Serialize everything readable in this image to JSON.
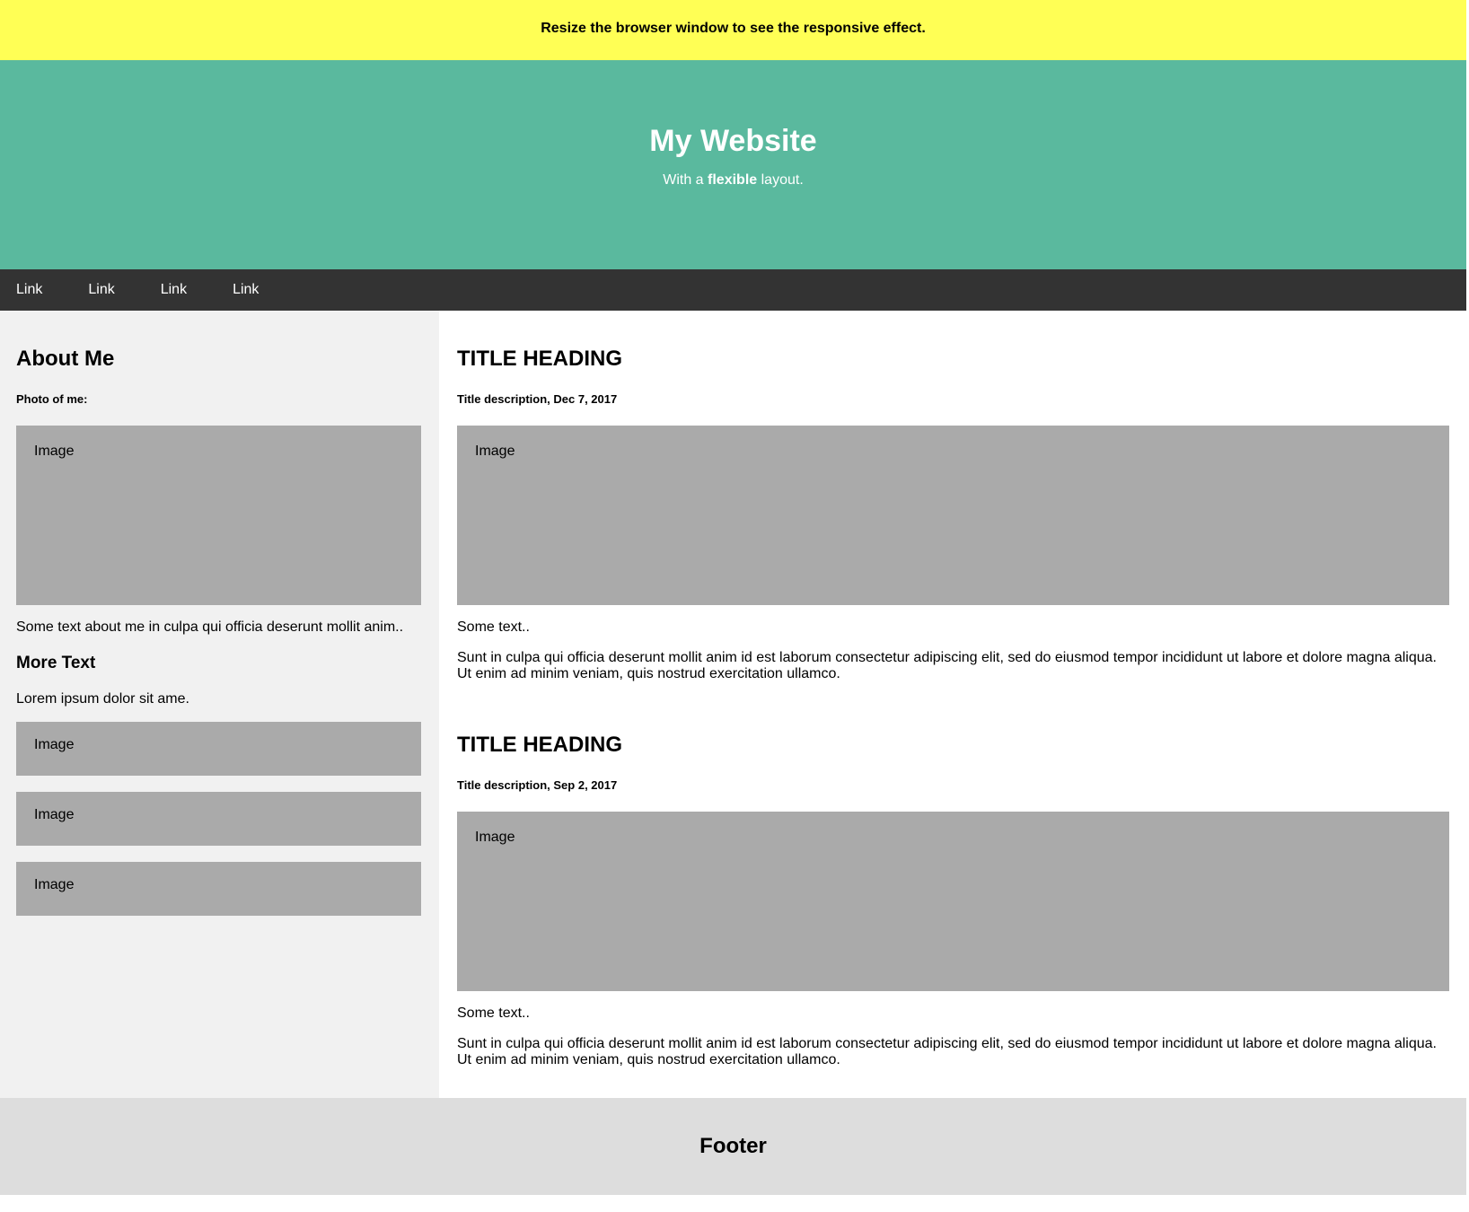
{
  "notice": {
    "text": "Resize the browser window to see the responsive effect."
  },
  "header": {
    "title": "My Website",
    "subtitle_pre": "With a ",
    "subtitle_bold": "flexible",
    "subtitle_post": " layout."
  },
  "nav": {
    "links": [
      "Link",
      "Link",
      "Link",
      "Link"
    ]
  },
  "side": {
    "heading": "About Me",
    "photo_label": "Photo of me:",
    "photo_placeholder": "Image",
    "about_text": "Some text about me in culpa qui officia deserunt mollit anim..",
    "more_heading": "More Text",
    "more_text": "Lorem ipsum dolor sit ame.",
    "images": [
      "Image",
      "Image",
      "Image"
    ]
  },
  "main": {
    "posts": [
      {
        "title": "TITLE HEADING",
        "description": "Title description, Dec 7, 2017",
        "image": "Image",
        "short_text": "Some text..",
        "body": "Sunt in culpa qui officia deserunt mollit anim id est laborum consectetur adipiscing elit, sed do eiusmod tempor incididunt ut labore et dolore magna aliqua. Ut enim ad minim veniam, quis nostrud exercitation ullamco."
      },
      {
        "title": "TITLE HEADING",
        "description": "Title description, Sep 2, 2017",
        "image": "Image",
        "short_text": "Some text..",
        "body": "Sunt in culpa qui officia deserunt mollit anim id est laborum consectetur adipiscing elit, sed do eiusmod tempor incididunt ut labore et dolore magna aliqua. Ut enim ad minim veniam, quis nostrud exercitation ullamco."
      }
    ]
  },
  "footer": {
    "title": "Footer"
  },
  "colors": {
    "notice_bg": "#ffff55",
    "header_bg": "#5ab99e",
    "nav_bg": "#333333",
    "side_bg": "#f1f1f1",
    "image_bg": "#aaaaaa",
    "footer_bg": "#dddddd"
  }
}
